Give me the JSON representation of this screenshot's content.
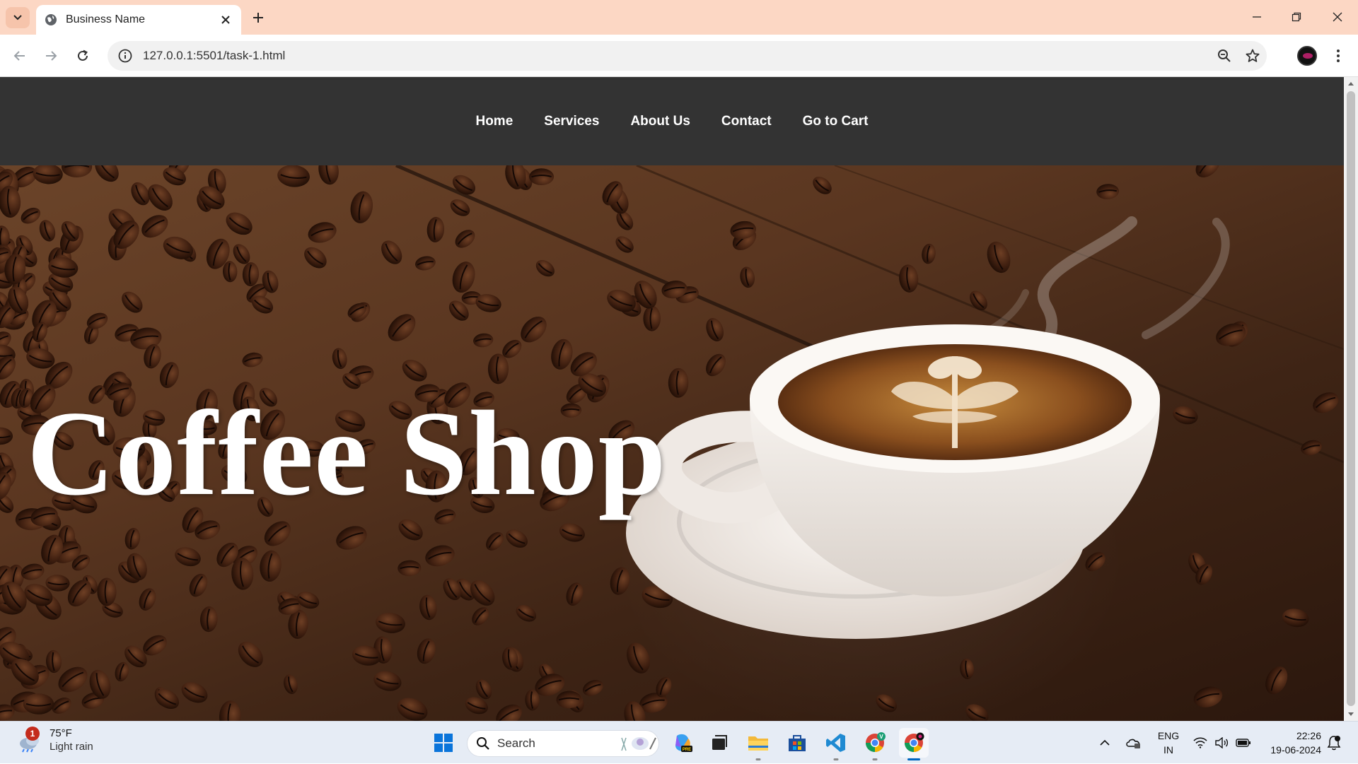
{
  "browser": {
    "tab_title": "Business Name",
    "url": "127.0.0.1:5501/task-1.html"
  },
  "site": {
    "nav": [
      "Home",
      "Services",
      "About Us",
      "Contact",
      "Go to Cart"
    ],
    "hero_title": "Coffee Shop"
  },
  "taskbar": {
    "weather_badge": "1",
    "temperature": "75°F",
    "condition": "Light rain",
    "search_placeholder": "Search",
    "lang_top": "ENG",
    "lang_bottom": "IN",
    "time": "22:26",
    "date": "19-06-2024",
    "apps": [
      "copilot-icon",
      "task-view-icon",
      "file-explorer-icon",
      "microsoft-store-icon",
      "vscode-icon",
      "chrome-profile-icon",
      "chrome-icon"
    ]
  },
  "colors": {
    "tabbar_bg": "#fcd7c4",
    "site_nav_bg": "#333333",
    "hero_text": "#ffffff",
    "coffee_dark": "#2b170d",
    "taskbar_bg": "#e6ecf5"
  }
}
